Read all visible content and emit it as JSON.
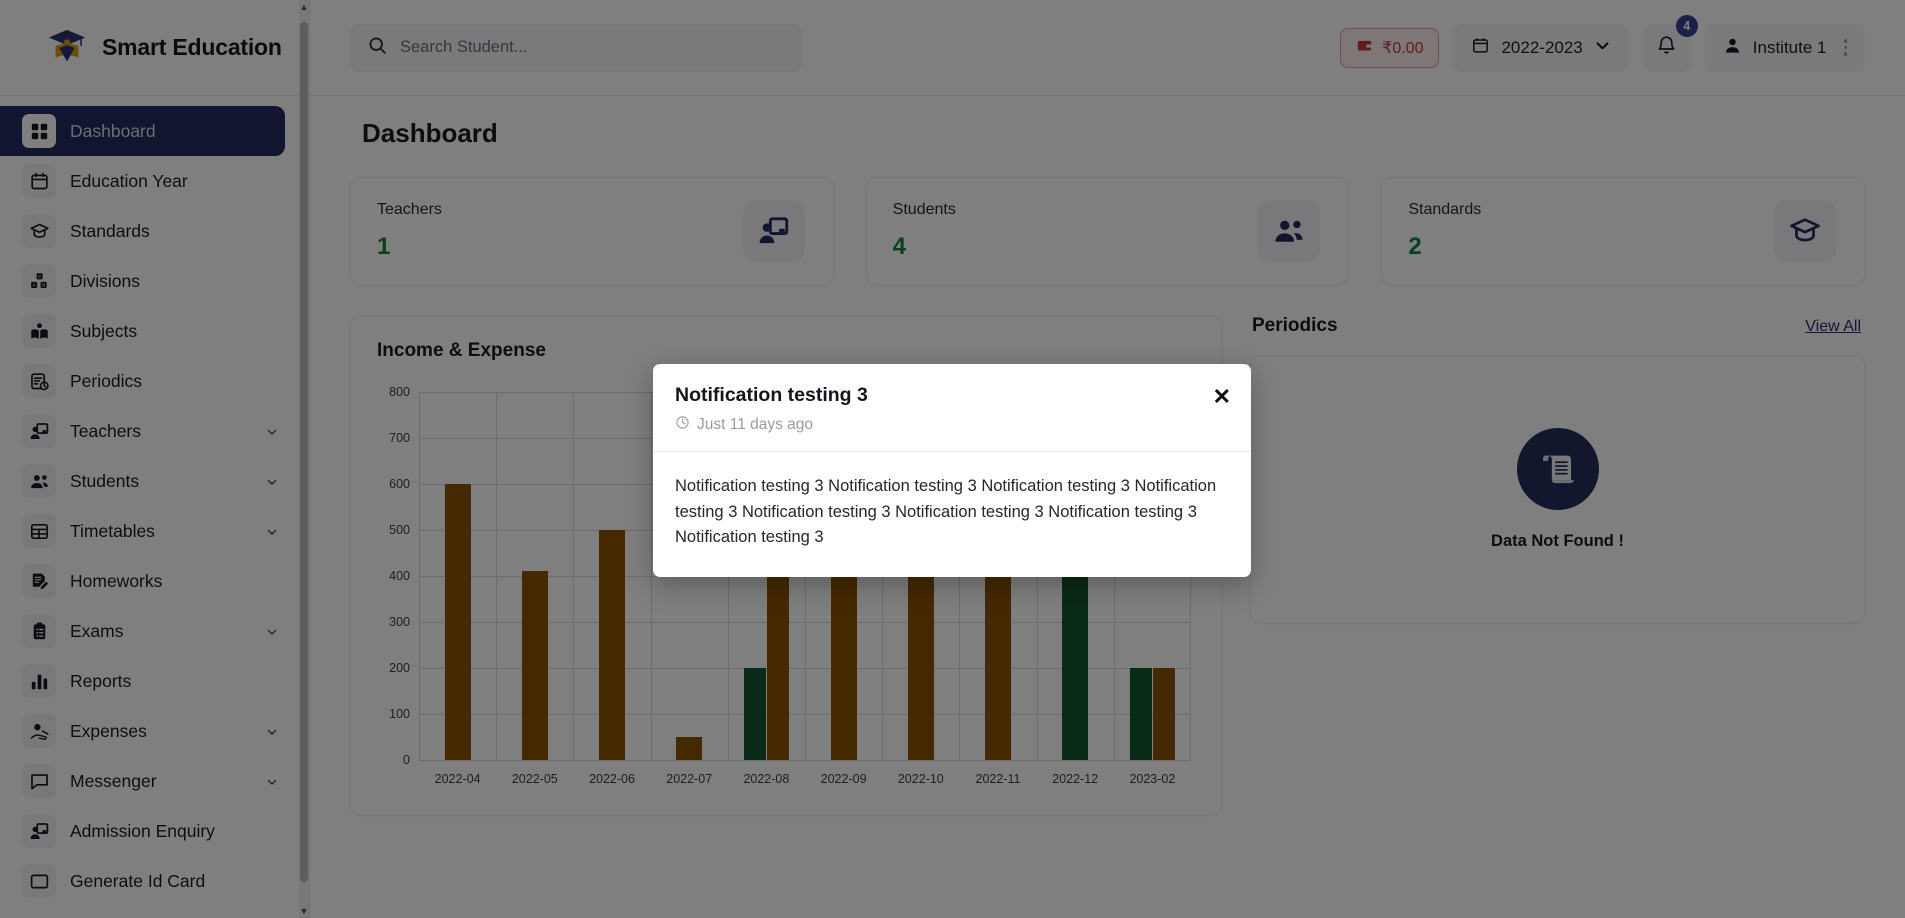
{
  "brand": {
    "name": "Smart Education",
    "logo_icon": "graduation-logo-icon"
  },
  "sidebar": {
    "items": [
      {
        "label": "Dashboard",
        "icon": "grid-icon",
        "active": true,
        "expandable": false
      },
      {
        "label": "Education Year",
        "icon": "calendar-icon",
        "active": false,
        "expandable": false
      },
      {
        "label": "Standards",
        "icon": "graduation-cap-icon",
        "active": false,
        "expandable": false
      },
      {
        "label": "Divisions",
        "icon": "blocks-abc-icon",
        "active": false,
        "expandable": false
      },
      {
        "label": "Subjects",
        "icon": "open-book-icon",
        "active": false,
        "expandable": false
      },
      {
        "label": "Periodics",
        "icon": "clipboard-clock-icon",
        "active": false,
        "expandable": false
      },
      {
        "label": "Teachers",
        "icon": "teacher-board-icon",
        "active": false,
        "expandable": true
      },
      {
        "label": "Students",
        "icon": "users-group-icon",
        "active": false,
        "expandable": true
      },
      {
        "label": "Timetables",
        "icon": "table-icon",
        "active": false,
        "expandable": true
      },
      {
        "label": "Homeworks",
        "icon": "document-pen-icon",
        "active": false,
        "expandable": false
      },
      {
        "label": "Exams",
        "icon": "clipboard-list-icon",
        "active": false,
        "expandable": true
      },
      {
        "label": "Reports",
        "icon": "bar-chart-icon",
        "active": false,
        "expandable": false
      },
      {
        "label": "Expenses",
        "icon": "hand-coin-icon",
        "active": false,
        "expandable": true
      },
      {
        "label": "Messenger",
        "icon": "chat-bubble-icon",
        "active": false,
        "expandable": true
      },
      {
        "label": "Admission Enquiry",
        "icon": "enquiry-board-icon",
        "active": false,
        "expandable": false
      },
      {
        "label": "Generate Id Card",
        "icon": "id-card-icon",
        "active": false,
        "expandable": false
      }
    ]
  },
  "topbar": {
    "search_placeholder": "Search Student...",
    "search_value": "",
    "search_icon": "search-icon",
    "wallet": {
      "icon": "wallet-icon",
      "amount": "₹0.00"
    },
    "year_select": {
      "icon": "calendar-icon",
      "value": "2022-2023",
      "caret_icon": "chevron-down-icon"
    },
    "notifications": {
      "icon": "bell-icon",
      "count": "4"
    },
    "user": {
      "icon": "user-icon",
      "name": "Institute 1",
      "menu_icon": "vertical-dots-icon"
    }
  },
  "main": {
    "page_title": "Dashboard",
    "stats": [
      {
        "label": "Teachers",
        "value": "1",
        "icon": "teacher-board-icon"
      },
      {
        "label": "Students",
        "value": "4",
        "icon": "users-group-icon"
      },
      {
        "label": "Standards",
        "value": "2",
        "icon": "graduation-cap-icon"
      }
    ],
    "periodics": {
      "title": "Periodics",
      "view_all_label": "View All",
      "empty_icon": "scroll-document-icon",
      "empty_text": "Data Not Found !"
    }
  },
  "chart_data": {
    "type": "bar",
    "title": "Income & Expense",
    "xlabel": "",
    "ylabel": "",
    "ylim": [
      0,
      800
    ],
    "yticks": [
      0,
      100,
      200,
      300,
      400,
      500,
      600,
      700,
      800
    ],
    "grid": true,
    "legend_position": "none",
    "categories": [
      "2022-04",
      "2022-05",
      "2022-06",
      "2022-07",
      "2022-08",
      "2022-09",
      "2022-10",
      "2022-11",
      "2022-12",
      "2023-02"
    ],
    "series": [
      {
        "name": "Income",
        "color": "#14572f",
        "values": [
          0,
          0,
          0,
          0,
          200,
          0,
          0,
          0,
          500,
          200
        ]
      },
      {
        "name": "Expense",
        "color": "#8a5300",
        "values": [
          600,
          410,
          500,
          50,
          450,
          550,
          550,
          550,
          0,
          200
        ]
      }
    ]
  },
  "modal": {
    "title": "Notification testing 3",
    "time_icon": "clock-icon",
    "time": "Just 11 days ago",
    "close_icon": "close-icon",
    "close_label": "✕",
    "body": "Notification testing 3 Notification testing 3 Notification testing 3 Notification testing 3 Notification testing 3 Notification testing 3 Notification testing 3 Notification testing 3"
  },
  "colors": {
    "sidebar_active": "#222b5e",
    "stat_value": "#17803a",
    "income": "#14572f",
    "expense": "#8a5300",
    "wallet_red": "#c23b3b",
    "badge": "#3b3f94"
  }
}
